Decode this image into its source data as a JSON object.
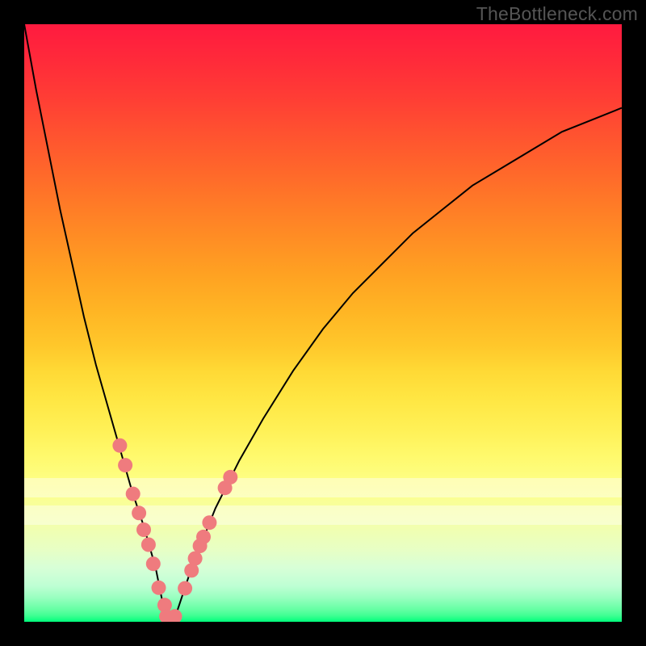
{
  "watermark": "TheBottleneck.com",
  "colors": {
    "dot": "#ef7b7e",
    "curve": "#000000"
  },
  "chart_data": {
    "type": "line",
    "title": "",
    "xlabel": "",
    "ylabel": "",
    "xlim": [
      0,
      100
    ],
    "ylim": [
      0,
      100
    ],
    "grid": false,
    "description": "V-shaped bottleneck curve on a vertical rainbow gradient (red=high bottleneck at top, green=none at bottom). Curve minimum ~x=24 touching y=0. Salmon dots mark sample points clustered on the lower portions of both arms of the curve. Two faint horizontal white bands near the bottom.",
    "series": [
      {
        "name": "bottleneck_curve",
        "x": [
          0,
          2,
          4,
          6,
          8,
          10,
          12,
          14,
          16,
          18,
          20,
          22,
          23,
          24,
          25,
          26,
          28,
          30,
          32,
          34,
          36,
          40,
          45,
          50,
          55,
          60,
          65,
          70,
          75,
          80,
          85,
          90,
          95,
          100
        ],
        "y": [
          100,
          89,
          79,
          69,
          60,
          51,
          43,
          36,
          29,
          22,
          16,
          9,
          4,
          0,
          0,
          3,
          9,
          14,
          19,
          23,
          27,
          34,
          42,
          49,
          55,
          60,
          65,
          69,
          73,
          76,
          79,
          82,
          84,
          86
        ]
      }
    ],
    "sample_points": [
      {
        "x": 16.0,
        "y": 29.5
      },
      {
        "x": 16.9,
        "y": 26.2
      },
      {
        "x": 18.2,
        "y": 21.4
      },
      {
        "x": 19.2,
        "y": 18.2
      },
      {
        "x": 20.0,
        "y": 15.4
      },
      {
        "x": 20.8,
        "y": 12.9
      },
      {
        "x": 21.6,
        "y": 9.7
      },
      {
        "x": 22.5,
        "y": 5.7
      },
      {
        "x": 23.5,
        "y": 2.8
      },
      {
        "x": 23.8,
        "y": 0.9
      },
      {
        "x": 25.2,
        "y": 0.9
      },
      {
        "x": 26.9,
        "y": 5.6
      },
      {
        "x": 28.0,
        "y": 8.6
      },
      {
        "x": 28.6,
        "y": 10.6
      },
      {
        "x": 29.4,
        "y": 12.7
      },
      {
        "x": 30.0,
        "y": 14.2
      },
      {
        "x": 31.0,
        "y": 16.6
      },
      {
        "x": 33.6,
        "y": 22.4
      },
      {
        "x": 34.5,
        "y": 24.2
      }
    ],
    "bands_y_percent": [
      76.0,
      80.6
    ]
  }
}
